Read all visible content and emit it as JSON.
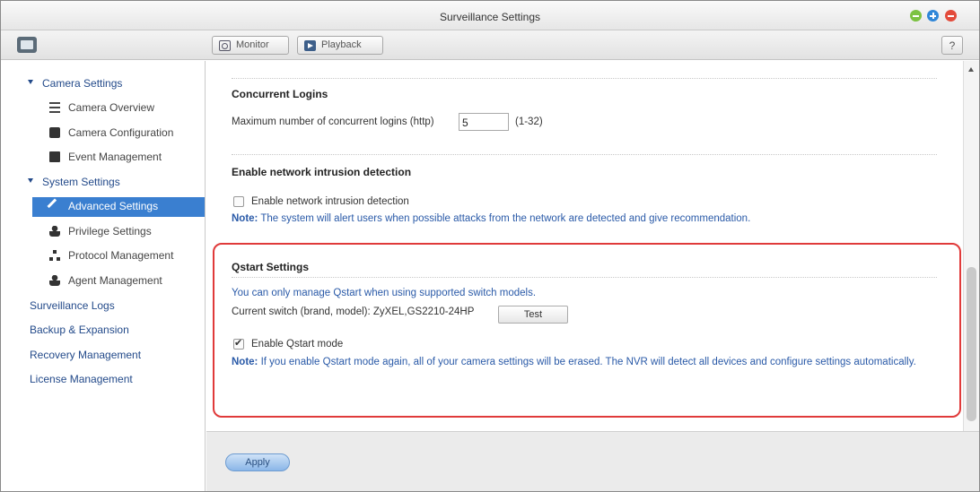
{
  "window": {
    "title": "Surveillance Settings"
  },
  "toolbar": {
    "monitor_label": "Monitor",
    "playback_label": "Playback",
    "help_label": "?"
  },
  "sidebar": {
    "camera_settings": "Camera Settings",
    "camera_overview": "Camera Overview",
    "camera_configuration": "Camera Configuration",
    "event_management": "Event Management",
    "system_settings": "System Settings",
    "advanced_settings": "Advanced Settings",
    "privilege_settings": "Privilege Settings",
    "protocol_management": "Protocol Management",
    "agent_management": "Agent Management",
    "surveillance_logs": "Surveillance Logs",
    "backup_expansion": "Backup & Expansion",
    "recovery_management": "Recovery Management",
    "license_management": "License Management"
  },
  "concurrent": {
    "title": "Concurrent Logins",
    "label": "Maximum number of concurrent logins (http)",
    "value": "5",
    "range": "(1-32)"
  },
  "intrusion": {
    "title": "Enable network intrusion detection",
    "checkbox_label": "Enable network intrusion detection",
    "checked": false,
    "note_prefix": "Note:",
    "note": "The system will alert users when possible attacks from the network are detected and give recommendation."
  },
  "qstart": {
    "title": "Qstart Settings",
    "info": "You can only manage Qstart when using supported switch models.",
    "current_switch_label": "Current switch (brand, model):",
    "current_switch_value": "ZyXEL,GS2210-24HP",
    "test_label": "Test",
    "checkbox_label": "Enable Qstart mode",
    "checked": true,
    "note_prefix": "Note:",
    "note": "If you enable Qstart mode again, all of your camera settings will be erased. The NVR will detect all devices and configure settings automatically."
  },
  "footer": {
    "apply_label": "Apply"
  }
}
